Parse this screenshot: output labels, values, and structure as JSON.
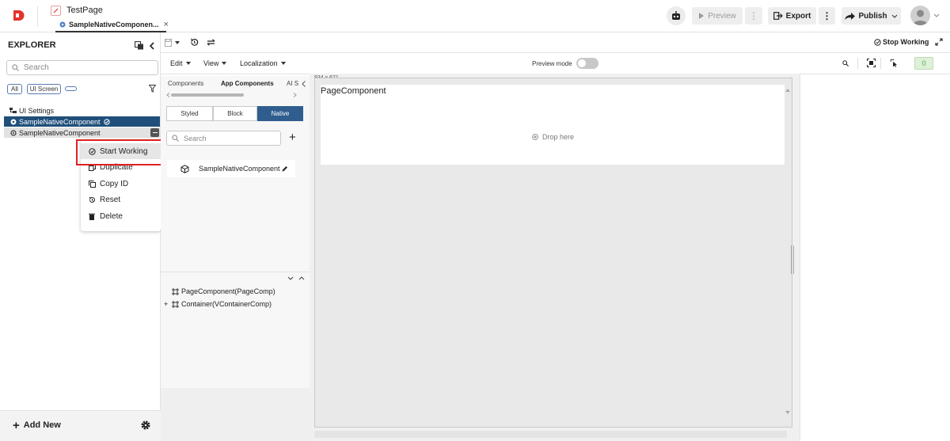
{
  "app": {
    "page_title": "TestPage",
    "tab_label": "SampleNativeComponen...",
    "tab_close": "×"
  },
  "toolbar": {
    "preview_label": "Preview",
    "export_label": "Export",
    "publish_label": "Publish",
    "more_glyph": "⋮"
  },
  "explorer": {
    "title": "EXPLORER",
    "search_placeholder": "Search",
    "filters": [
      "All",
      "UI Screen"
    ],
    "tree": {
      "ui_settings": "UI Settings",
      "item_selected": "SampleNativeComponent",
      "item_hover": "SampleNativeComponent"
    },
    "add_new": "Add New"
  },
  "context_menu": {
    "items": [
      "Start Working",
      "Duplicate",
      "Copy ID",
      "Reset",
      "Delete"
    ]
  },
  "editor": {
    "menus": [
      "Edit",
      "View",
      "Localization"
    ],
    "preview_mode_label": "Preview mode",
    "stop_working_label": "Stop Working",
    "badge_count": "0"
  },
  "components_panel": {
    "tabs": [
      "Components",
      "App Components",
      "AI S"
    ],
    "segments": [
      "Styled",
      "Block",
      "Native"
    ],
    "active_segment": "Native",
    "search_placeholder": "Search",
    "item": "SampleNativeComponent",
    "tree": [
      "PageComponent(PageComp)",
      "Container(VContainerComp)"
    ],
    "tree_expander": "+"
  },
  "canvas": {
    "size_label": "934 x 671",
    "page_component_label": "PageComponent",
    "drop_label": "Drop here"
  },
  "colors": {
    "brand_red": "#e5322d",
    "selected_blue": "#1f4f7a",
    "segment_active": "#2f5e8e",
    "highlight_red": "#e02020",
    "badge_green": "#4caf50"
  }
}
